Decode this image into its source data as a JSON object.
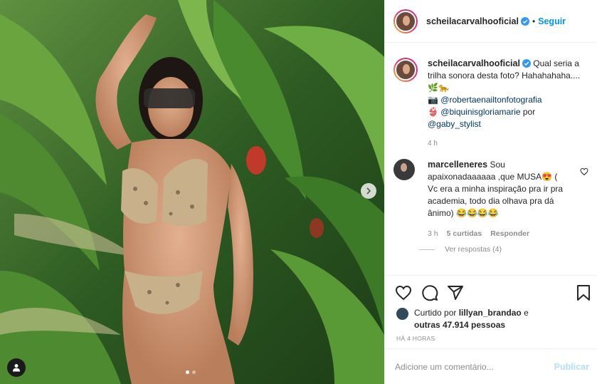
{
  "post": {
    "username": "scheilacarvalhooficial",
    "separator": "•",
    "follow_label": "Seguir"
  },
  "caption": {
    "username": "scheilacarvalhooficial",
    "text_line1": "Qual seria a trilha sonora desta foto? Hahahahaha.... 🌿🐆",
    "photo_emoji": "📷",
    "photo_credit": "@robertaenailtonfotografia",
    "bikini_emoji": "👙",
    "bikini_credit": "@biquinisgloriamarie",
    "by_word": "por",
    "stylist_credit": "@gaby_stylist",
    "time": "4 h"
  },
  "comment": {
    "username": "marcelleneres",
    "text": "Sou apaixonadaaaaaa ,que MUSA😍 ( Vc era a minha inspiração pra ir pra academia, todo dia olhava pra dá ânimo) 😂😂😂😂",
    "time": "3 h",
    "likes": "5 curtidas",
    "reply_label": "Responder",
    "view_replies": "Ver respostas (4)"
  },
  "likes": {
    "prefix": "Curtido por",
    "user": "lillyan_brandao",
    "and": "e",
    "others": "outras 47.914 pessoas"
  },
  "timestamp": "HÁ 4 HORAS",
  "composer": {
    "placeholder": "Adicione um comentário...",
    "post_label": "Publicar"
  },
  "icons": [
    "heart-icon",
    "comment-icon",
    "share-icon",
    "bookmark-icon",
    "chevron-right-icon",
    "user-tag-icon",
    "verified-icon"
  ],
  "colors": {
    "link": "#0095f6",
    "mention": "#00376b",
    "muted": "#8e8e8e",
    "post_disabled": "#b2dffc"
  }
}
